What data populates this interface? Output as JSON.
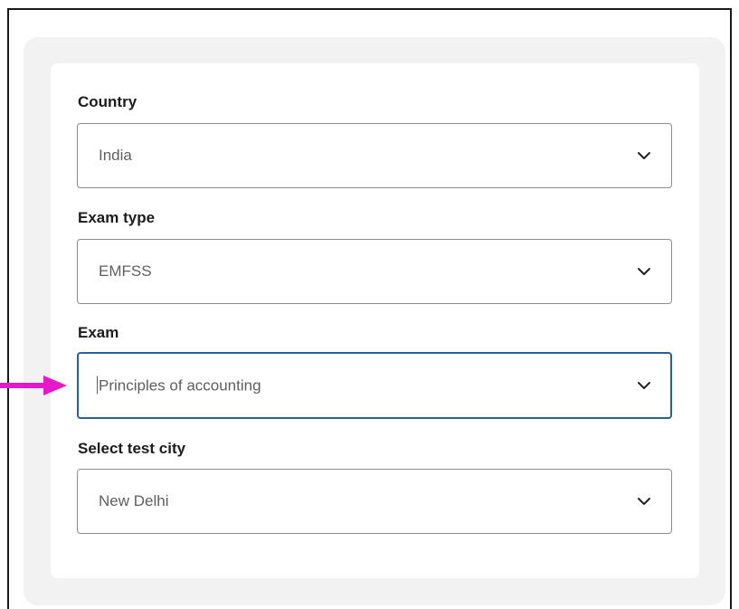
{
  "form": {
    "country": {
      "label": "Country",
      "value": "India"
    },
    "exam_type": {
      "label": "Exam type",
      "value": "EMFSS"
    },
    "exam": {
      "label": "Exam",
      "value": "Principles of accounting",
      "focused": true
    },
    "test_city": {
      "label": "Select test city",
      "value": "New Delhi"
    }
  },
  "icons": {
    "dropdown": "chevron-down-icon",
    "annotation": "arrow-right-icon"
  },
  "colors": {
    "panel_bg": "#f2f2f2",
    "card_bg": "#ffffff",
    "border": "#8c8c8c",
    "focus_border": "#2b5f9e",
    "annotation_arrow": "#e619c8",
    "value_text": "#5f5f5f"
  }
}
